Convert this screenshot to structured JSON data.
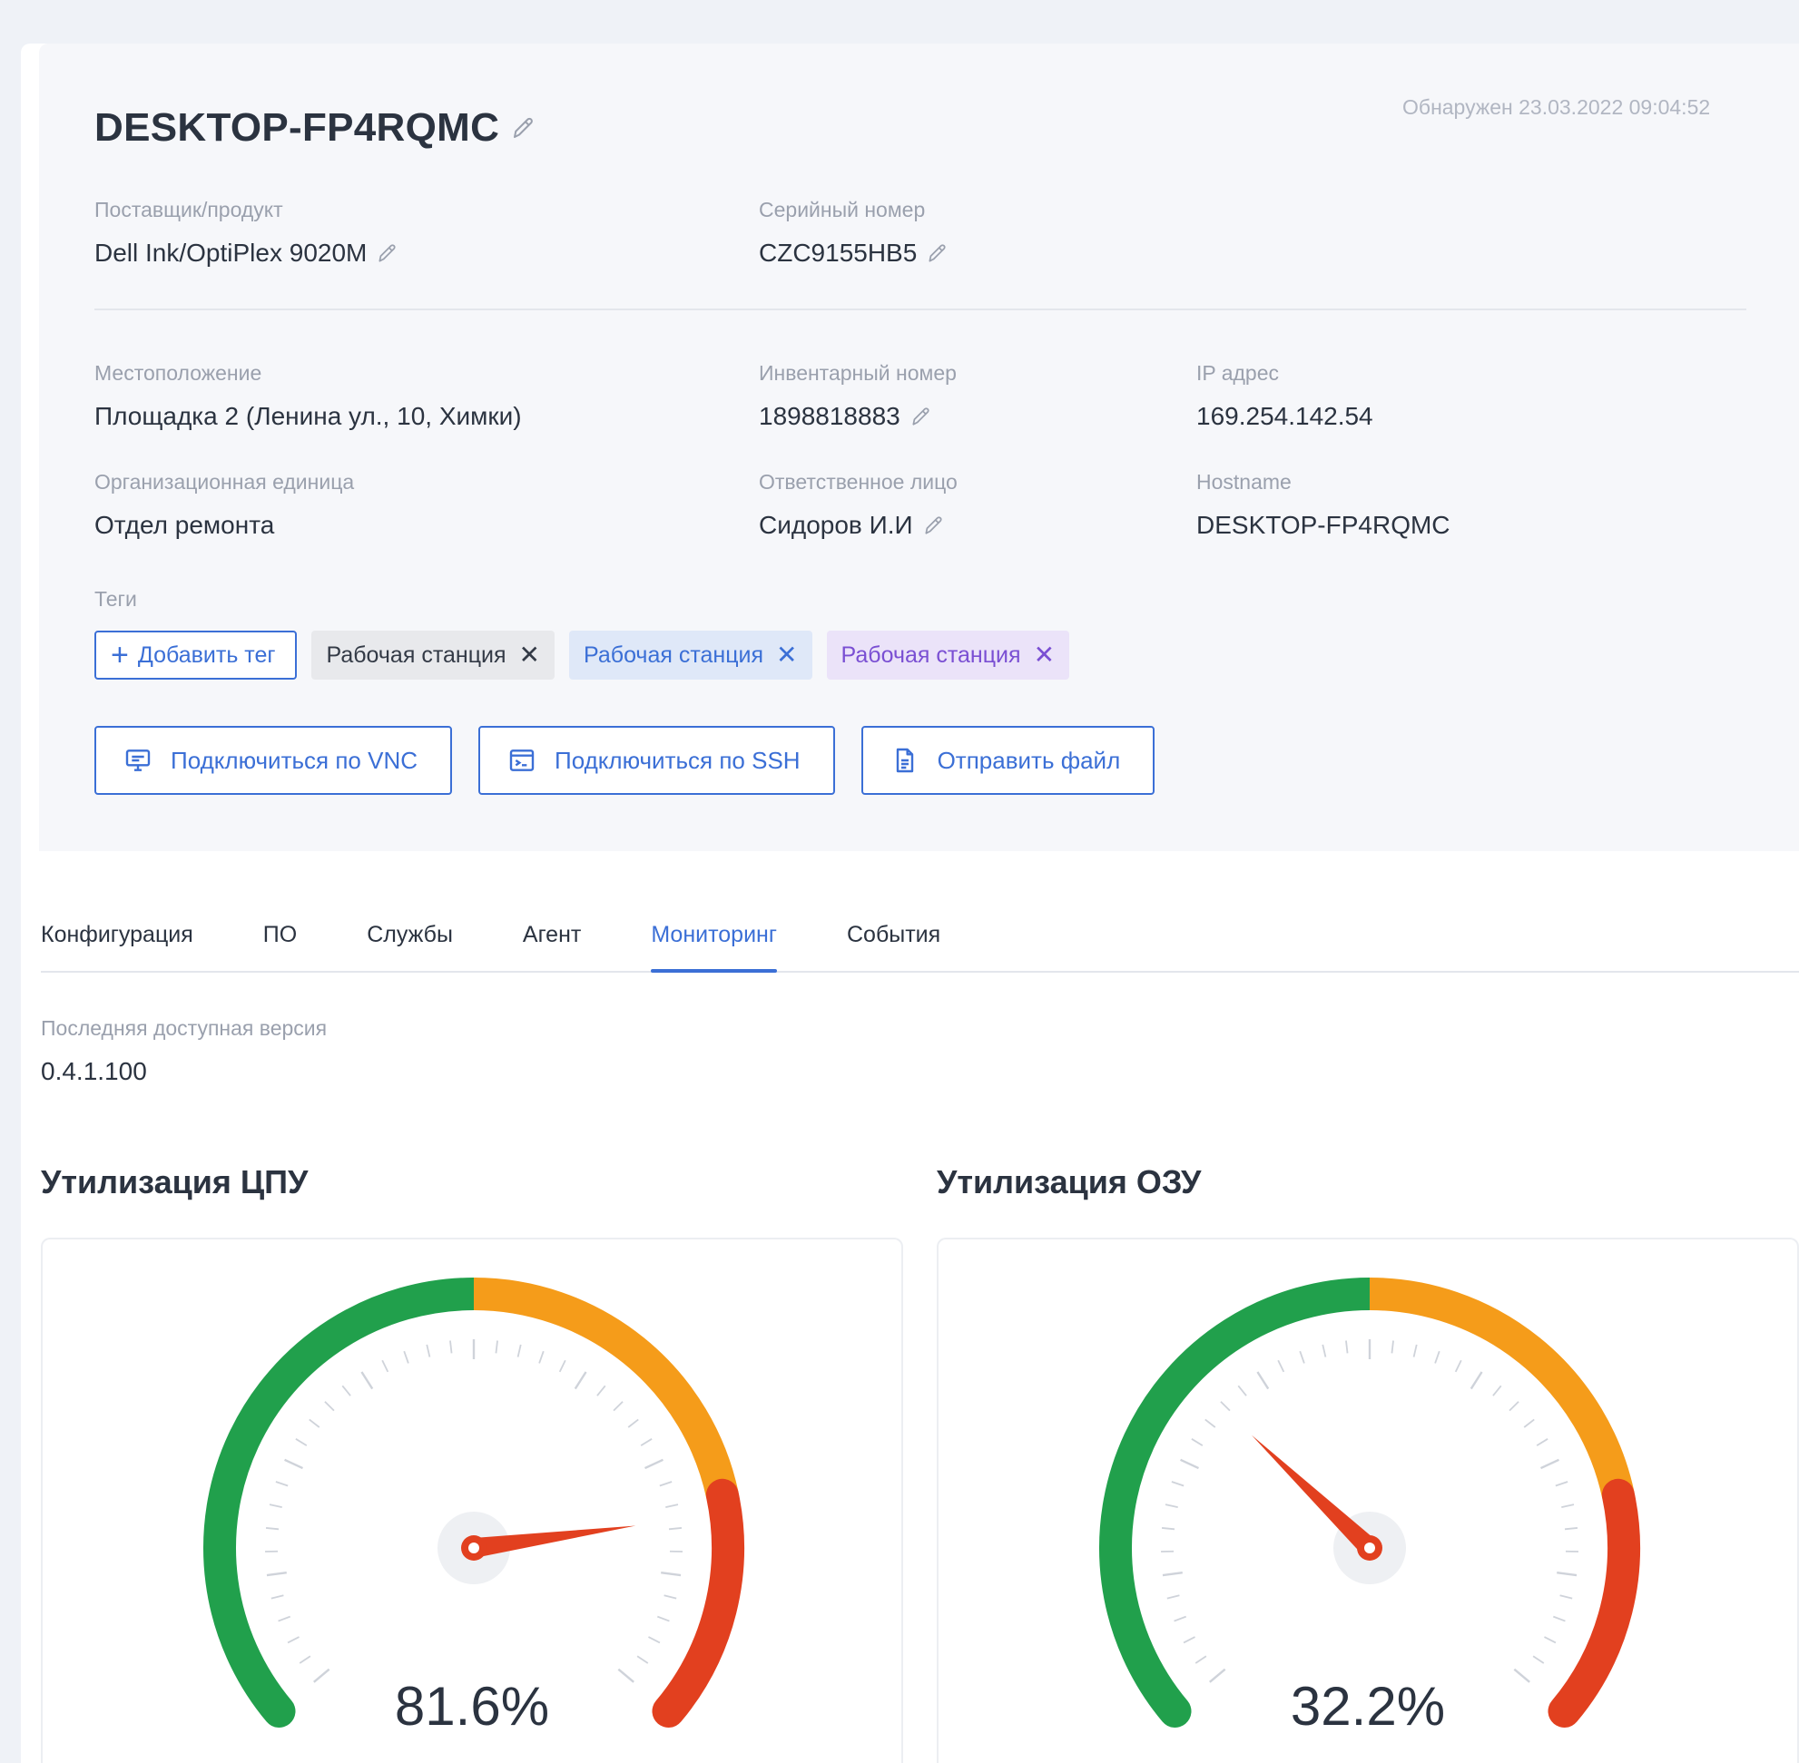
{
  "device": {
    "title": "DESKTOP-FP4RQMC",
    "discovered": "Обнаружен 23.03.2022 09:04:52"
  },
  "fields": {
    "vendor": {
      "label": "Поставщик/продукт",
      "value": "Dell Ink/OptiPlex 9020M"
    },
    "serial": {
      "label": "Серийный номер",
      "value": "CZC9155HB5"
    },
    "location": {
      "label": "Местоположение",
      "value": "Площадка 2 (Ленина ул., 10, Химки)"
    },
    "inventory": {
      "label": "Инвентарный номер",
      "value": "1898818883"
    },
    "ip": {
      "label": "IP адрес",
      "value": "169.254.142.54"
    },
    "org_unit": {
      "label": "Организационная единица",
      "value": "Отдел ремонта"
    },
    "responsible": {
      "label": "Ответственное лицо",
      "value": "Сидоров И.И"
    },
    "hostname": {
      "label": "Hostname",
      "value": "DESKTOP-FP4RQMC"
    }
  },
  "tags": {
    "label": "Теги",
    "add_label": "Добавить тег",
    "items": [
      {
        "label": "Рабочая станция",
        "style": "gray"
      },
      {
        "label": "Рабочая станция",
        "style": "blue"
      },
      {
        "label": "Рабочая станция",
        "style": "violet"
      }
    ]
  },
  "actions": {
    "vnc": "Подключиться по VNC",
    "ssh": "Подключиться по SSH",
    "send_file": "Отправить файл"
  },
  "tabs": [
    {
      "label": "Конфигурация",
      "active": false
    },
    {
      "label": "ПО",
      "active": false
    },
    {
      "label": "Службы",
      "active": false
    },
    {
      "label": "Агент",
      "active": false
    },
    {
      "label": "Мониторинг",
      "active": true
    },
    {
      "label": "События",
      "active": false
    }
  ],
  "monitoring": {
    "latest_version_label": "Последняя доступная версия",
    "latest_version_value": "0.4.1.100",
    "cpu": {
      "title": "Утилизация ЦПУ",
      "percent": 81.6,
      "value_text": "81.6%"
    },
    "ram": {
      "title": "Утилизация ОЗУ",
      "percent": 32.2,
      "value_text": "32.2%"
    }
  },
  "colors": {
    "accent": "#3b6fd6",
    "gauge_green": "#21a04c",
    "gauge_orange": "#f59c1a",
    "gauge_red": "#e2401f",
    "needle": "#e2401f"
  }
}
